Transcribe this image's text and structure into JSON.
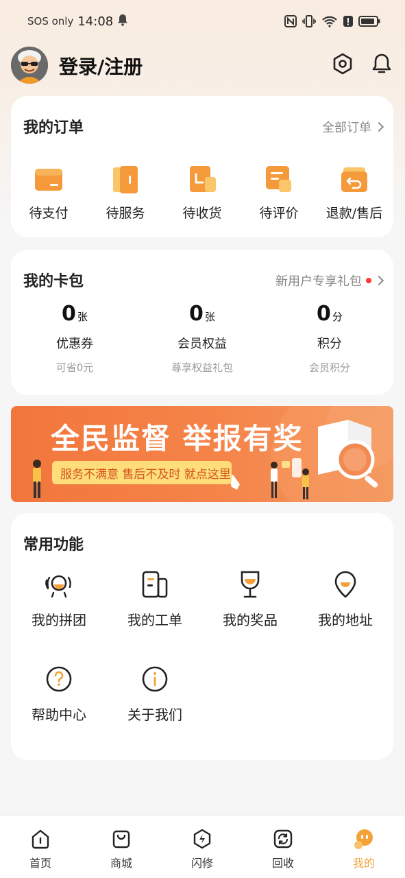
{
  "status_bar": {
    "network": "SOS only",
    "time": "14:08",
    "icons": [
      "bell-icon",
      "nfc-icon",
      "vibrate-icon",
      "wifi-icon",
      "alert-icon",
      "battery-icon"
    ]
  },
  "header": {
    "login_text": "登录/注册",
    "avatar": "avatar",
    "settings_icon": "hexagon-settings-icon",
    "notification_icon": "bell-icon"
  },
  "orders": {
    "title": "我的订单",
    "link": "全部订单",
    "items": [
      {
        "label": "待支付",
        "icon": "wallet-icon"
      },
      {
        "label": "待服务",
        "icon": "door-icon"
      },
      {
        "label": "待收货",
        "icon": "package-icon"
      },
      {
        "label": "待评价",
        "icon": "comment-icon"
      },
      {
        "label": "退款/售后",
        "icon": "return-icon"
      }
    ]
  },
  "wallet": {
    "title": "我的卡包",
    "link": "新用户专享礼包",
    "items": [
      {
        "value": "0",
        "unit": "张",
        "label": "优惠券",
        "sub": "可省0元"
      },
      {
        "value": "0",
        "unit": "张",
        "label": "会员权益",
        "sub": "尊享权益礼包"
      },
      {
        "value": "0",
        "unit": "分",
        "label": "积分",
        "sub": "会员积分"
      }
    ]
  },
  "banner": {
    "title": "全民监督 举报有奖",
    "subtitle": "服务不满意 售后不及时 就点这里"
  },
  "functions": {
    "title": "常用功能",
    "items": [
      {
        "label": "我的拼团",
        "icon": "group-icon"
      },
      {
        "label": "我的工单",
        "icon": "work-order-icon"
      },
      {
        "label": "我的奖品",
        "icon": "trophy-icon"
      },
      {
        "label": "我的地址",
        "icon": "location-pin-icon"
      },
      {
        "label": "帮助中心",
        "icon": "help-icon"
      },
      {
        "label": "关于我们",
        "icon": "info-icon"
      }
    ]
  },
  "nav": {
    "items": [
      {
        "label": "首页",
        "icon": "home-icon"
      },
      {
        "label": "商城",
        "icon": "shopping-bag-icon"
      },
      {
        "label": "闪修",
        "icon": "lightning-icon"
      },
      {
        "label": "回收",
        "icon": "recycle-icon"
      },
      {
        "label": "我的",
        "icon": "mascot-profile-icon"
      }
    ],
    "active_index": 4,
    "active_color": "#f0a33a"
  },
  "colors": {
    "accent": "#f5a13a",
    "banner_bg": "#f2763c",
    "red_dot": "#ff3b30"
  }
}
